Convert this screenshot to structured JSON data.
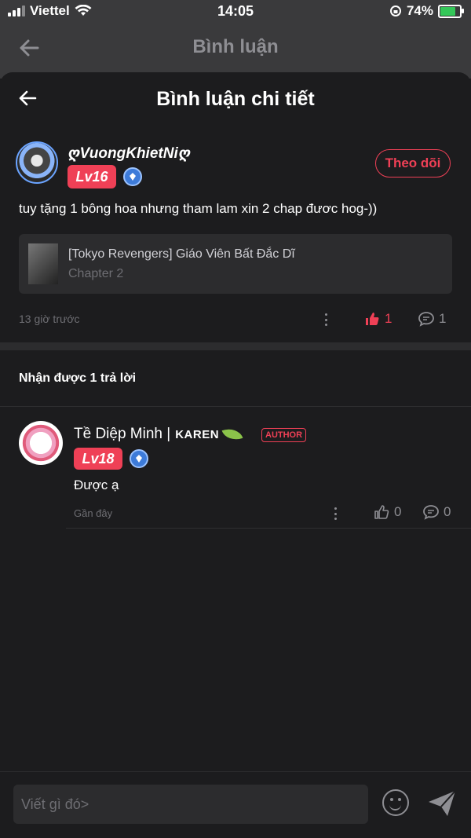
{
  "status": {
    "carrier": "Viettel",
    "time": "14:05",
    "battery": "74%",
    "battery_level": 0.74
  },
  "behind_header": {
    "title": "Bình luận"
  },
  "sheet": {
    "title": "Bình luận chi tiết"
  },
  "comment": {
    "username": "ღVuongKhietNiღ",
    "level": "Lv16",
    "follow_label": "Theo dõi",
    "text": "tuy tặng 1 bông hoa nhưng tham lam xin 2 chap đươc hog-))",
    "story_title": "[Tokyo Revengers] Giáo Viên Bất Đắc Dĩ",
    "story_chapter": "Chapter 2",
    "time": "13 giờ trước",
    "likes": "1",
    "replies": "1"
  },
  "replies_header": "Nhận được 1 trả lời",
  "reply": {
    "name": "Tề Diệp Minh |",
    "tag": "KAREN",
    "badge": "AUTHOR",
    "level": "Lv18",
    "text": "Được ạ",
    "time": "Gần đây",
    "likes": "0",
    "replies": "0"
  },
  "input": {
    "placeholder": "Viết gì đó>"
  },
  "colors": {
    "accent": "#ef4056",
    "background": "#1c1c1e",
    "card": "#2c2c2e"
  }
}
